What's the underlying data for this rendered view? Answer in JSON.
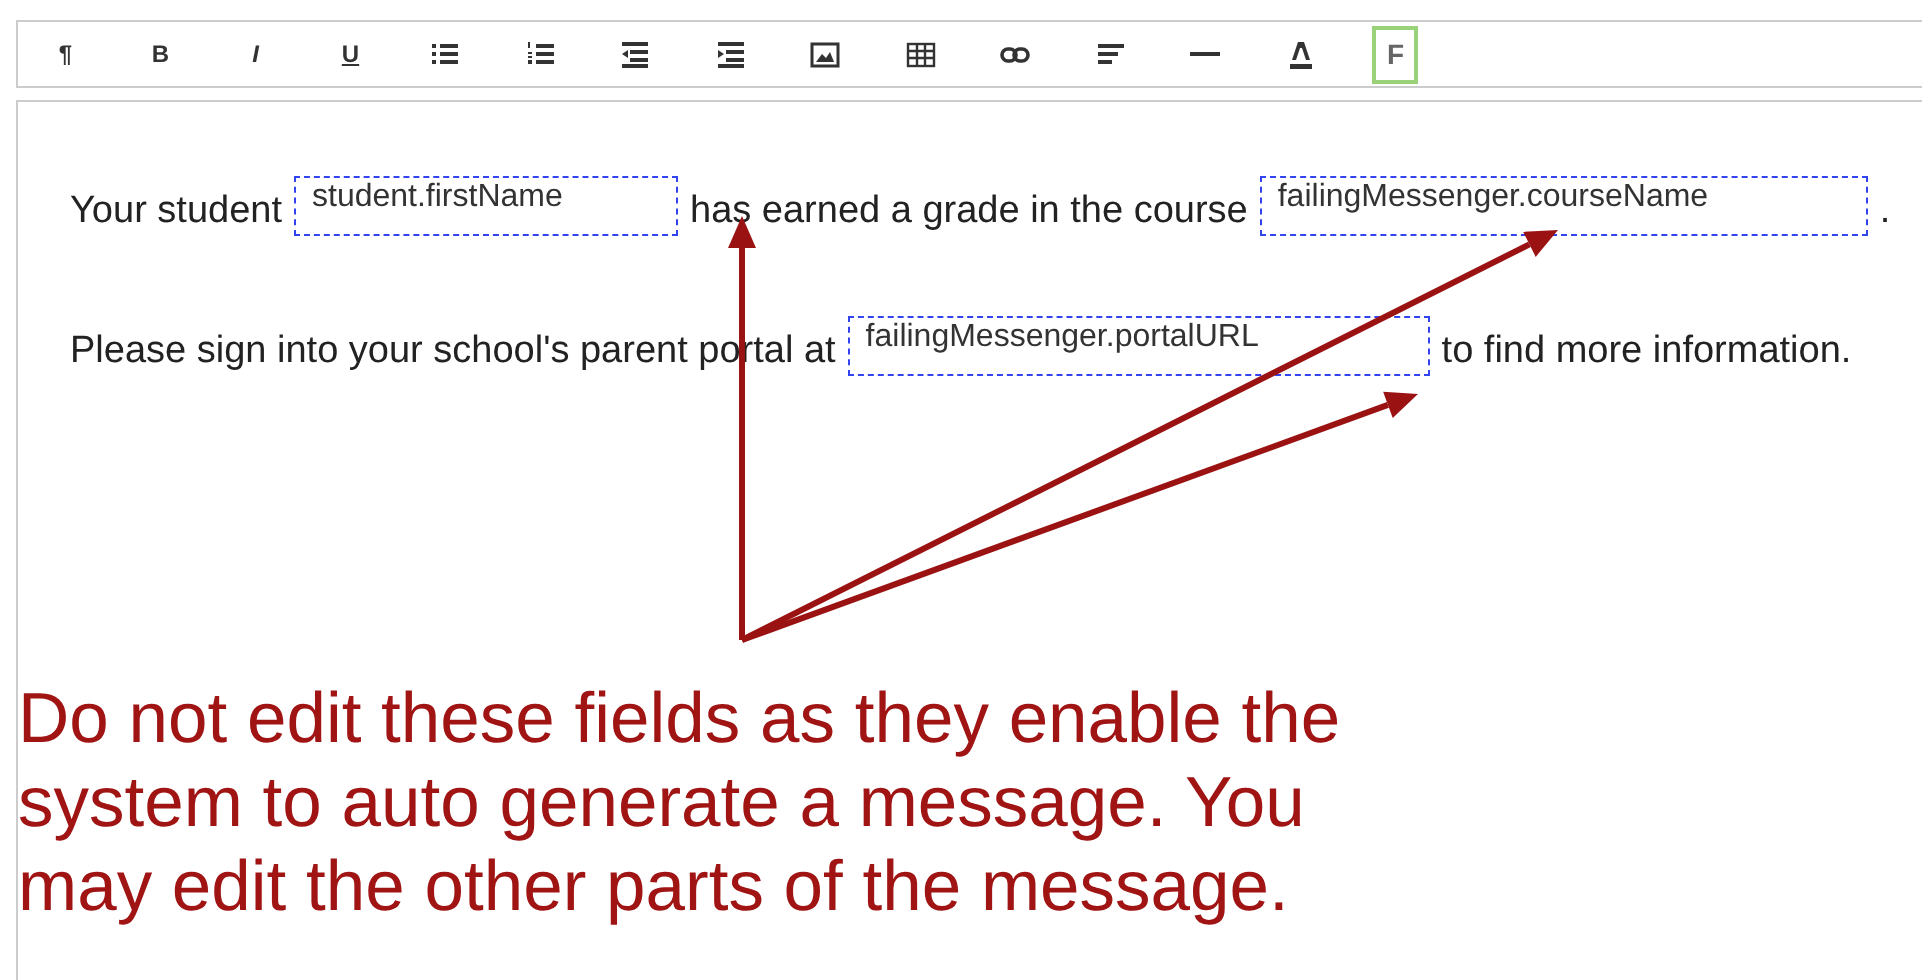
{
  "toolbar": [
    {
      "kind": "text",
      "label": "¶",
      "selected": false
    },
    {
      "kind": "text",
      "label": "B",
      "selected": false
    },
    {
      "kind": "text",
      "label": "I",
      "selected": false
    },
    {
      "kind": "text",
      "label": "U",
      "selected": false
    },
    {
      "kind": "bullets",
      "selected": false
    },
    {
      "kind": "numbers",
      "selected": false
    },
    {
      "kind": "outdent",
      "selected": false
    },
    {
      "kind": "indent",
      "selected": false
    },
    {
      "kind": "image",
      "selected": false
    },
    {
      "kind": "table",
      "selected": false
    },
    {
      "kind": "link",
      "selected": false
    },
    {
      "kind": "align",
      "selected": false
    },
    {
      "kind": "rule",
      "selected": false
    },
    {
      "kind": "color",
      "selected": false
    },
    {
      "kind": "text",
      "label": "F",
      "selected": true
    }
  ],
  "paragraphs": [
    [
      {
        "kind": "text",
        "text": "Your student"
      },
      {
        "kind": "field",
        "text": "student.firstName"
      },
      {
        "kind": "text",
        "text": "has earned a grade in the course"
      },
      {
        "kind": "field",
        "text": "failingMessenger.courseName"
      },
      {
        "kind": "text",
        "text": "."
      }
    ],
    [
      {
        "kind": "text",
        "text": "Please sign into your school's parent portal at"
      },
      {
        "kind": "field",
        "text": "failingMessenger.portalURL"
      },
      {
        "kind": "text",
        "text": "to find more information."
      }
    ]
  ],
  "note": "Do not edit these fields as they enable the system to auto generate a message. You may edit the other parts of the message."
}
